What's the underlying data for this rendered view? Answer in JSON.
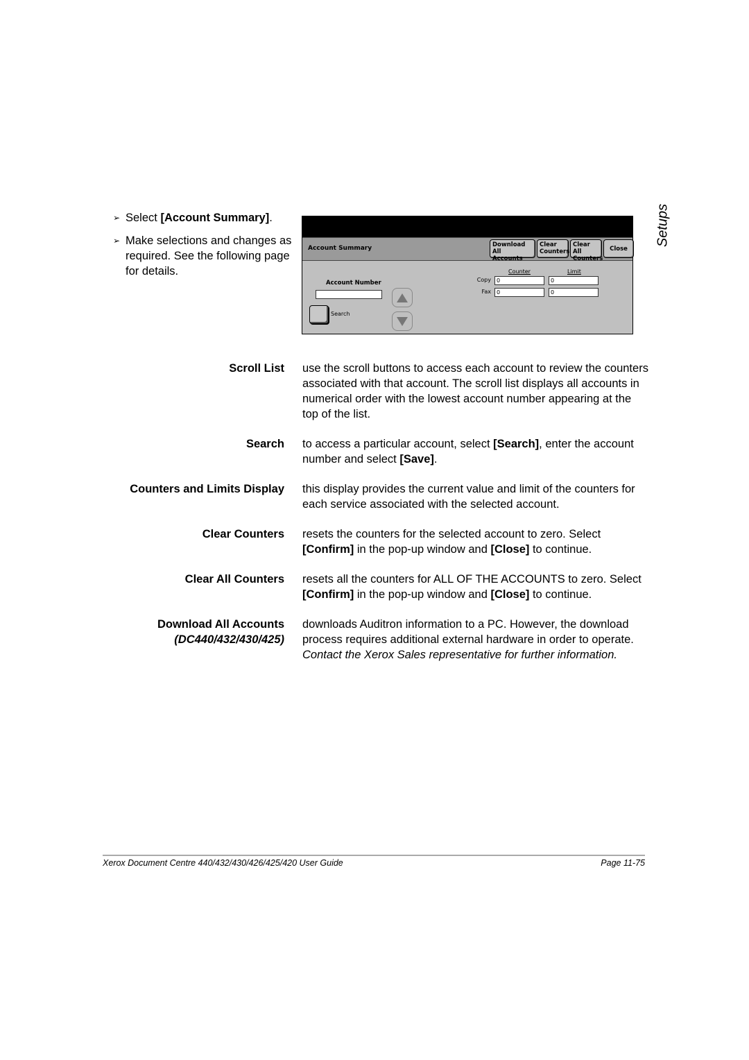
{
  "side_tab": "Setups",
  "intro": {
    "steps": [
      {
        "prefix": "Select ",
        "bold": "[Account Summary]",
        "suffix": "."
      },
      {
        "text": "Make selections and changes as required. See the following page for details."
      }
    ],
    "arrow_icon": "➢"
  },
  "screen": {
    "title": "Account Summary",
    "buttons": {
      "download_line1": "Download",
      "download_line2": "All Accounts",
      "clear_line1": "Clear",
      "clear_line2": "Counters",
      "clear_all_line1": "Clear All",
      "clear_all_line2": "Counters",
      "close": "Close"
    },
    "counter_header": "Counter",
    "limit_header": "Limit",
    "rows": [
      {
        "label": "Copy",
        "counter": "0",
        "limit": "0"
      },
      {
        "label": "Fax",
        "counter": "0",
        "limit": "0"
      }
    ],
    "account_number_label": "Account Number",
    "account_number_value": "",
    "search_label": "Search"
  },
  "definitions": [
    {
      "term": "Scroll List",
      "desc": "use the scroll buttons to access each account to review the counters associated with that account. The scroll list displays all accounts in numerical order with the lowest account number appearing at the top of the list."
    },
    {
      "term": "Search",
      "desc_parts": [
        "to access a particular account, select ",
        "[Search]",
        ", enter the account number and select ",
        "[Save]",
        "."
      ]
    },
    {
      "term": "Counters and Limits Display",
      "desc": "this display provides the current value and limit of the counters for each service associated with the selected account."
    },
    {
      "term": "Clear Counters",
      "desc_parts": [
        "resets the counters for the selected account to zero. Select ",
        "[Confirm]",
        " in the pop-up window and ",
        "[Close]",
        " to continue."
      ]
    },
    {
      "term": "Clear All Counters",
      "desc_parts": [
        "resets all the counters for ALL OF THE ACCOUNTS to zero. Select ",
        "[Confirm]",
        " in the pop-up window and ",
        "[Close]",
        " to continue."
      ]
    },
    {
      "term": "Download All Accounts",
      "term_sub": "(DC440/432/430/425)",
      "desc_plain": "downloads Auditron information to a PC. However, the download process requires additional external hardware in order to operate. ",
      "desc_italic": "Contact the Xerox Sales representative for further information."
    }
  ],
  "footer": {
    "guide_title": "Xerox Document Centre 440/432/430/426/425/420 User Guide",
    "page": "Page 11-75"
  }
}
